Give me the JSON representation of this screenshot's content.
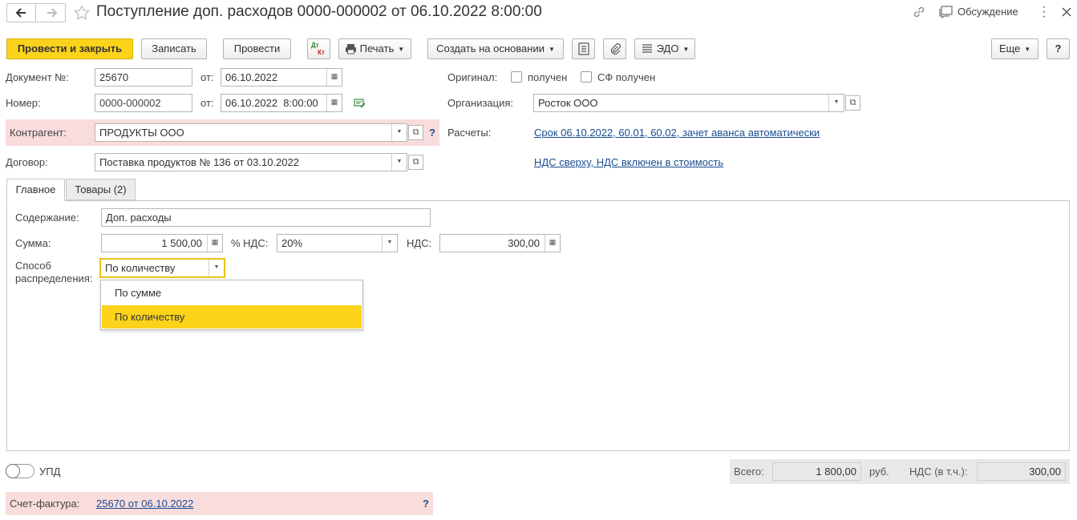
{
  "header": {
    "title": "Поступление доп. расходов 0000-000002 от 06.10.2022 8:00:00",
    "discussion_label": "Обсуждение"
  },
  "toolbar": {
    "post_close": "Провести и закрыть",
    "save": "Записать",
    "post": "Провести",
    "dt_kt_top": "Дт",
    "dt_kt_bottom": "Кт",
    "print": "Печать",
    "create_based": "Создать на основании",
    "edo": "ЭДО",
    "more": "Еще",
    "help": "?"
  },
  "form": {
    "doc_no_label": "Документ №:",
    "doc_no": "25670",
    "from_label": "от:",
    "doc_date": "06.10.2022",
    "number_label": "Номер:",
    "number": "0000-000002",
    "number_date": "06.10.2022  8:00:00",
    "counterparty_label": "Контрагент:",
    "counterparty": "ПРОДУКТЫ ООО",
    "counterparty_help": "?",
    "contract_label": "Договор:",
    "contract": "Поставка продуктов № 136 от 03.10.2022",
    "original_label": "Оригинал:",
    "received_label": "получен",
    "sf_received_label": "СФ получен",
    "org_label": "Организация:",
    "org": "Росток ООО",
    "settlements_label": "Расчеты:",
    "settlements_link": "Срок 06.10.2022, 60.01, 60.02, зачет аванса автоматически",
    "vat_link": "НДС сверху, НДС включен в стоимость"
  },
  "tabs": [
    {
      "label": "Главное"
    },
    {
      "label": "Товары (2)"
    }
  ],
  "main": {
    "content_label": "Содержание:",
    "content": "Доп. расходы",
    "sum_label": "Сумма:",
    "sum": "1 500,00",
    "vat_rate_label": "% НДС:",
    "vat_rate": "20%",
    "vat_label": "НДС:",
    "vat": "300,00",
    "distribution_label_1": "Способ",
    "distribution_label_2": "распределения:",
    "distribution": "По количеству",
    "options": [
      "По сумме",
      "По количеству"
    ]
  },
  "footer": {
    "upd_label": "УПД",
    "total_label": "Всего:",
    "total": "1 800,00",
    "currency": "руб.",
    "vat_incl_label": "НДС (в т.ч.):",
    "vat_incl": "300,00",
    "invoice_label": "Счет-фактура:",
    "invoice_link": "25670 от 06.10.2022",
    "invoice_help": "?"
  },
  "colors": {
    "primary": "#fcd31b",
    "highlight": "#f9dcdc",
    "link": "#1a4d92"
  }
}
